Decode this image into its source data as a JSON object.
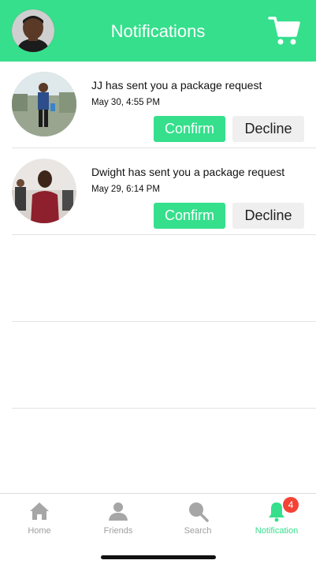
{
  "header": {
    "title": "Notifications",
    "accent_color": "#35df8c",
    "avatar_icon": "user-avatar",
    "cart_icon": "shopping-cart-icon"
  },
  "notifications": [
    {
      "message": "JJ has sent you a package request",
      "time": "May 30, 4:55 PM",
      "confirm_label": "Confirm",
      "decline_label": "Decline"
    },
    {
      "message": "Dwight has sent you a package request",
      "time": "May 29, 6:14 PM",
      "confirm_label": "Confirm",
      "decline_label": "Decline"
    }
  ],
  "tabs": [
    {
      "label": "Home",
      "icon": "home-icon"
    },
    {
      "label": "Friends",
      "icon": "person-icon"
    },
    {
      "label": "Search",
      "icon": "search-icon"
    },
    {
      "label": "Notification",
      "icon": "bell-icon",
      "badge": "4",
      "active": true
    }
  ]
}
